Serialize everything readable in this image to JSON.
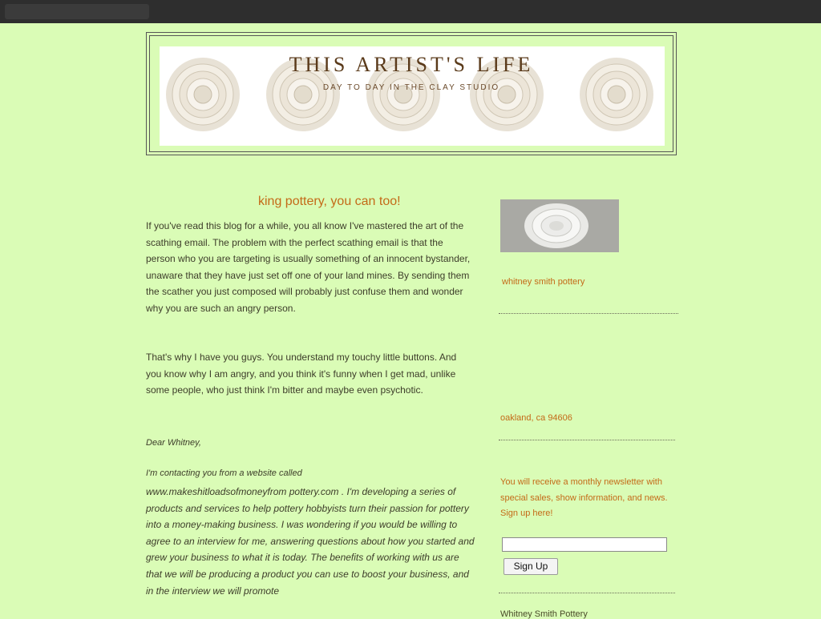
{
  "topbar": {
    "left_items": [
      "",
      "",
      ""
    ],
    "right_items": [
      "",
      ""
    ]
  },
  "banner": {
    "title": "THIS ARTIST'S LIFE",
    "subtitle": "DAY TO DAY IN THE CLAY STUDIO"
  },
  "post": {
    "date": "",
    "title": "king pottery, you can too!",
    "p1": "If you've read this blog for a while, you all know I've mastered the art of the scathing email. The problem with the perfect scathing email is that the person who you are targeting is usually something of an innocent bystander, unaware that they have just set off one of your land mines. By sending them the scather you just composed will probably just confuse them and wonder why you are such an angry person.",
    "p1_link": "the art",
    "p2": "That's why I have you guys. You understand my touchy little buttons. And you know why I am angry, and you think it's funny when I get mad, unlike some people, who just think I'm bitter and maybe even psychotic.",
    "sig": "Dear Whitney,",
    "intro2": "I'm contacting you from a website called",
    "p3": "www.makeshitloadsofmoneyfrom pottery.com . I'm developing a series of products and services to help pottery hobbyists turn their passion for pottery into a money-making business. I was wondering if you would be willing to agree to an interview for me, answering questions about how you started and grew your business to what it is today. The benefits of working with us are that we will be producing a product you can use to boost your business, and in the interview we will promote"
  },
  "sidebar": {
    "heading": "",
    "heading2": "",
    "name": "whitney smith pottery",
    "links": [
      "",
      "",
      "",
      "",
      "",
      "",
      ""
    ],
    "address": "oakland, ca 94606",
    "news_title": "",
    "news_text": "You will receive a monthly newsletter with special sales, show information, and news. Sign up here!",
    "email_placeholder": "",
    "signup_label": "Sign Up",
    "footer": "Whitney Smith Pottery"
  },
  "colors": {
    "background": "#dafcb6",
    "accent": "#c46a18",
    "topbar": "#2e2e2e"
  }
}
